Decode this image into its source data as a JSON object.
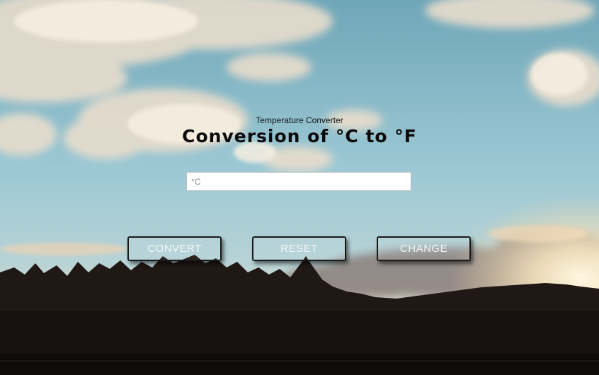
{
  "header": {
    "subtitle": "Temperature Converter",
    "title": "Conversion of °C to °F"
  },
  "input": {
    "placeholder": "°C",
    "value": ""
  },
  "buttons": {
    "convert": "CONVERT",
    "reset": "RESET",
    "change": "CHANGE"
  },
  "colors": {
    "sky": "#8fc3d2",
    "clouds": "#efe6d8",
    "trees": "#1d1612",
    "sun": "#fff6dc"
  },
  "background": {
    "description_icon": "lake-sunset-landscape"
  }
}
